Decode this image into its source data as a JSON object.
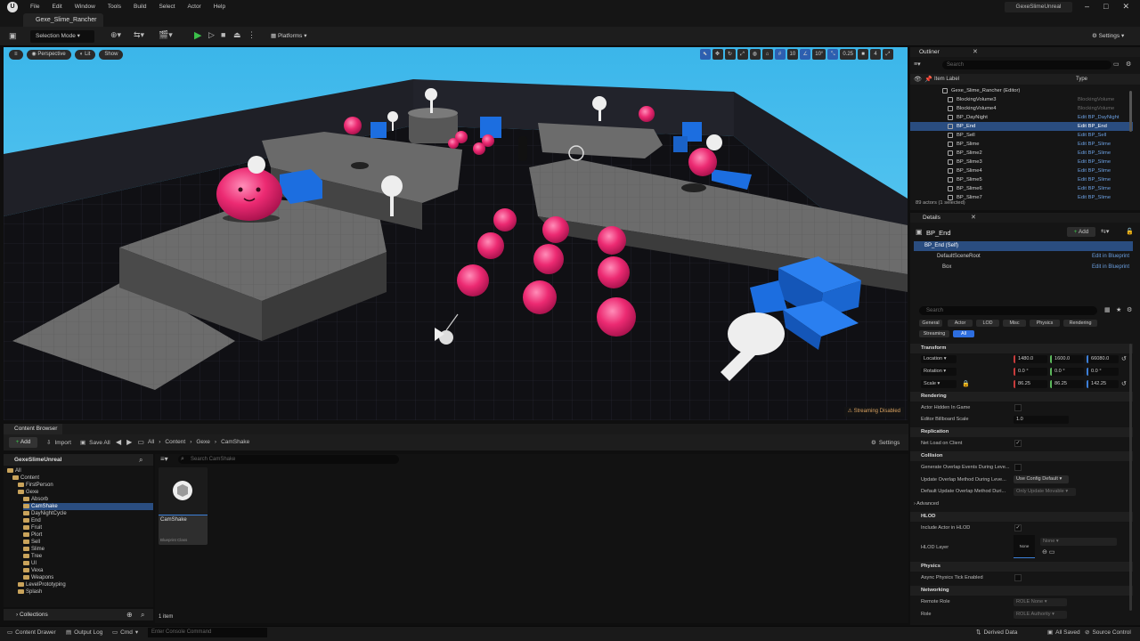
{
  "menu": [
    "File",
    "Edit",
    "Window",
    "Tools",
    "Build",
    "Select",
    "Actor",
    "Help"
  ],
  "project_name": "GexeSlimeUnreal",
  "level_tab": "Gexe_Slime_Rancher",
  "toolbar": {
    "mode": "Selection Mode",
    "platforms": "Platforms",
    "settings": "Settings"
  },
  "viewport": {
    "perspective": "Perspective",
    "lit": "Lit",
    "show": "Show",
    "grid": "10",
    "angle": "10°",
    "scale": "0.25",
    "cams": "4",
    "streaming": "Streaming Disabled"
  },
  "content_browser": {
    "tab": "Content Browser",
    "add": "Add",
    "import": "Import",
    "save_all": "Save All",
    "path": [
      "All",
      "Content",
      "Gexe",
      "CamShake"
    ],
    "settings": "Settings",
    "tree_root": "GexeSlimeUnreal",
    "tree": [
      {
        "label": "All",
        "depth": 0
      },
      {
        "label": "Content",
        "depth": 1
      },
      {
        "label": "FirstPerson",
        "depth": 2
      },
      {
        "label": "Gexe",
        "depth": 2
      },
      {
        "label": "Absorb",
        "depth": 3
      },
      {
        "label": "CamShake",
        "depth": 3,
        "selected": true
      },
      {
        "label": "DayNightCycle",
        "depth": 3
      },
      {
        "label": "End",
        "depth": 3
      },
      {
        "label": "Fruit",
        "depth": 3
      },
      {
        "label": "Plort",
        "depth": 3
      },
      {
        "label": "Sell",
        "depth": 3
      },
      {
        "label": "Slime",
        "depth": 3
      },
      {
        "label": "Tree",
        "depth": 3
      },
      {
        "label": "UI",
        "depth": 3
      },
      {
        "label": "Vexa",
        "depth": 3
      },
      {
        "label": "Weapons",
        "depth": 3
      },
      {
        "label": "LevelPrototyping",
        "depth": 2
      },
      {
        "label": "Splash",
        "depth": 2
      }
    ],
    "search_placeholder": "Search CamShake",
    "asset_name": "CamShake",
    "asset_type": "Blueprint Class",
    "item_count": "1 item",
    "collections": "Collections"
  },
  "status": {
    "content_drawer": "Content Drawer",
    "output_log": "Output Log",
    "cmd": "Cmd",
    "console_placeholder": "Enter Console Command",
    "derived_data": "Derived Data",
    "all_saved": "All Saved",
    "source_control": "Source Control"
  },
  "outliner": {
    "tab": "Outliner",
    "search_placeholder": "Search",
    "col_label": "Item Label",
    "col_type": "Type",
    "rows": [
      {
        "name": "Gexe_Slime_Rancher (Editor)",
        "type": ""
      },
      {
        "name": "BlockingVolume3",
        "type": "BlockingVolume",
        "gray": true
      },
      {
        "name": "BlockingVolume4",
        "type": "BlockingVolume",
        "gray": true
      },
      {
        "name": "BP_DayNight",
        "type": "Edit BP_DayNight"
      },
      {
        "name": "BP_End",
        "type": "Edit BP_End",
        "selected": true
      },
      {
        "name": "BP_Sell",
        "type": "Edit BP_Sell"
      },
      {
        "name": "BP_Slime",
        "type": "Edit BP_Slime"
      },
      {
        "name": "BP_Slime2",
        "type": "Edit BP_Slime"
      },
      {
        "name": "BP_Slime3",
        "type": "Edit BP_Slime"
      },
      {
        "name": "BP_Slime4",
        "type": "Edit BP_Slime"
      },
      {
        "name": "BP_Slime5",
        "type": "Edit BP_Slime"
      },
      {
        "name": "BP_Slime6",
        "type": "Edit BP_Slime"
      },
      {
        "name": "BP_Slime7",
        "type": "Edit BP_Slime"
      }
    ],
    "actor_count": "89 actors (1 selected)"
  },
  "details": {
    "tab": "Details",
    "actor": "BP_End",
    "add": "Add",
    "components": [
      {
        "name": "BP_End (Self)",
        "link": ""
      },
      {
        "name": "DefaultSceneRoot",
        "link": "Edit in Blueprint"
      },
      {
        "name": "Box",
        "link": "Edit in Blueprint"
      }
    ],
    "search_placeholder": "Search",
    "filters": [
      "General",
      "Actor",
      "LOD",
      "Misc",
      "Physics",
      "Rendering",
      "Streaming",
      "All"
    ],
    "transform": {
      "title": "Transform",
      "location_label": "Location",
      "location": [
        "1480.0",
        "1600.0",
        "66080.0"
      ],
      "rotation_label": "Rotation",
      "rotation": [
        "0.0 °",
        "0.0 °",
        "0.0 °"
      ],
      "scale_label": "Scale",
      "scale": [
        "86.25",
        "86.25",
        "142.25"
      ]
    },
    "rendering": {
      "title": "Rendering",
      "hidden": "Actor Hidden In Game",
      "billboard": "Editor Billboard Scale",
      "billboard_value": "1.0"
    },
    "replication": {
      "title": "Replication",
      "net_load": "Net Load on Client"
    },
    "collision": {
      "title": "Collision",
      "overlap": "Generate Overlap Events During Leve...",
      "update": "Update Overlap Method During Leve...",
      "update_value": "Use Config Default",
      "default": "Default Update Overlap Method Duri...",
      "default_value": "Only Update Movable"
    },
    "advanced": "Advanced",
    "hlod": {
      "title": "HLOD",
      "include": "Include Actor in HLOD",
      "layer": "HLOD Layer",
      "layer_value": "None",
      "layer_thumb": "None"
    },
    "physics": {
      "title": "Physics",
      "async": "Async Physics Tick Enabled"
    },
    "networking": {
      "title": "Networking",
      "remote": "Remote Role",
      "remote_value": "ROLE None",
      "role": "Role",
      "role_value": "ROLE Authority"
    }
  },
  "colors": {
    "accent": "#2a4d80",
    "link": "#6b9fe0",
    "slime": "#e8256b",
    "sky": "#49c3f0",
    "cube": "#1c6ee0"
  }
}
